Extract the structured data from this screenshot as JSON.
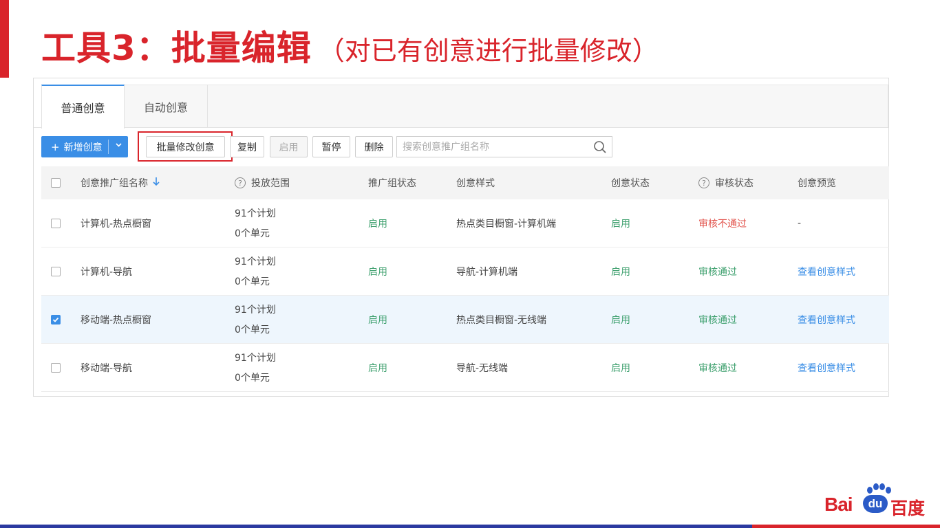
{
  "slide": {
    "title_main": "工具3：批量编辑",
    "title_sub": "（对已有创意进行批量修改）"
  },
  "tabs": [
    {
      "label": "普通创意",
      "active": true
    },
    {
      "label": "自动创意",
      "active": false
    }
  ],
  "toolbar": {
    "add_label": "新增创意",
    "batch_edit_label": "批量修改创意",
    "copy_label": "复制",
    "enable_label": "启用",
    "pause_label": "暂停",
    "delete_label": "删除",
    "search_placeholder": "搜索创意推广组名称"
  },
  "table": {
    "headers": {
      "name": "创意推广组名称",
      "scope": "投放范围",
      "group_status": "推广组状态",
      "style": "创意样式",
      "creative_status": "创意状态",
      "review_status": "审核状态",
      "preview": "创意预览"
    },
    "rows": [
      {
        "checked": false,
        "name": "计算机-热点橱窗",
        "plans": "91个计划",
        "units": "0个单元",
        "group_status": "启用",
        "style": "热点类目橱窗-计算机端",
        "creative_status": "启用",
        "review_status": "审核不通过",
        "review_ok": false,
        "preview": "-"
      },
      {
        "checked": false,
        "name": "计算机-导航",
        "plans": "91个计划",
        "units": "0个单元",
        "group_status": "启用",
        "style": "导航-计算机端",
        "creative_status": "启用",
        "review_status": "审核通过",
        "review_ok": true,
        "preview": "查看创意样式"
      },
      {
        "checked": true,
        "name": "移动端-热点橱窗",
        "plans": "91个计划",
        "units": "0个单元",
        "group_status": "启用",
        "style": "热点类目橱窗-无线端",
        "creative_status": "启用",
        "review_status": "审核通过",
        "review_ok": true,
        "preview": "查看创意样式"
      },
      {
        "checked": false,
        "name": "移动端-导航",
        "plans": "91个计划",
        "units": "0个单元",
        "group_status": "启用",
        "style": "导航-无线端",
        "creative_status": "启用",
        "review_status": "审核通过",
        "review_ok": true,
        "preview": "查看创意样式"
      }
    ]
  },
  "logo": {
    "text": "Bai",
    "du": "du",
    "cn": "百度"
  },
  "colors": {
    "brand_red": "#d9242b",
    "accent_blue": "#3a8ee6",
    "status_green": "#3ea06e",
    "status_red": "#e2554e"
  }
}
